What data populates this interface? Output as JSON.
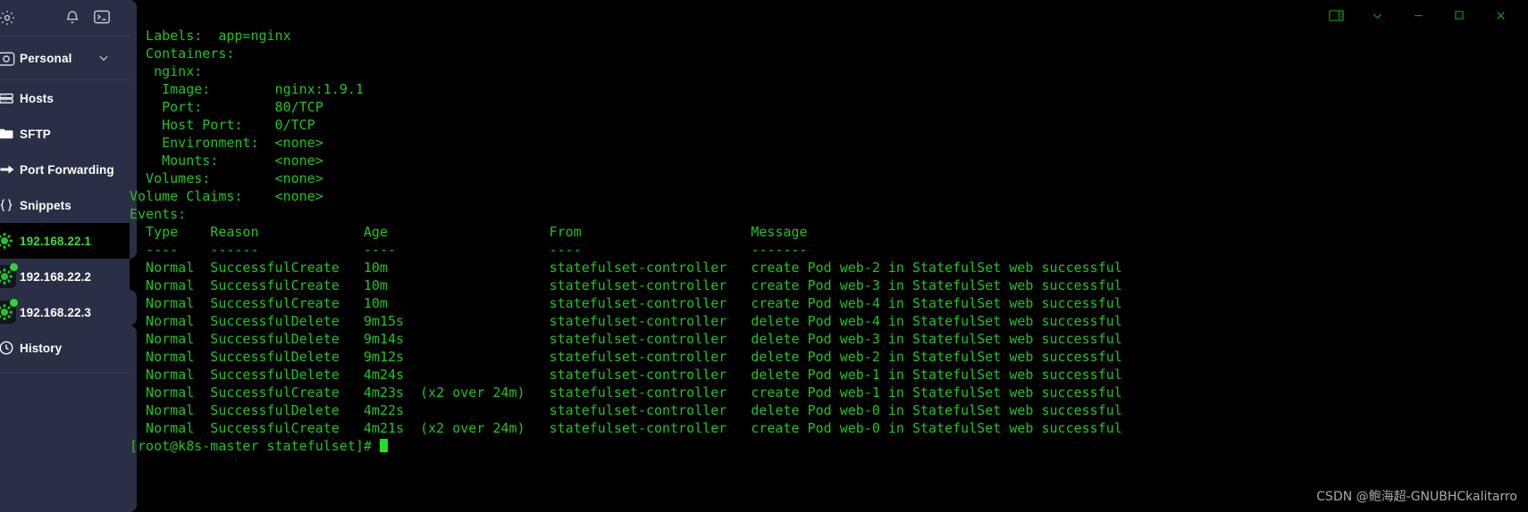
{
  "window_controls": [
    {
      "name": "split-pane",
      "glyph": "split"
    },
    {
      "name": "chevron-down",
      "glyph": "chev"
    },
    {
      "name": "minimize",
      "glyph": "min"
    },
    {
      "name": "maximize",
      "glyph": "max"
    },
    {
      "name": "close",
      "glyph": "close"
    }
  ],
  "sidebar": {
    "top_icons": [
      {
        "name": "settings-icon",
        "label": "Settings"
      },
      {
        "name": "bell-icon",
        "label": "Notifications"
      },
      {
        "name": "terminal-icon",
        "label": "Terminal"
      }
    ],
    "profile": {
      "label": "Personal",
      "icon": "account-icon",
      "chevron": "chevron-down-icon"
    },
    "items": [
      {
        "label": "Hosts",
        "icon": "hosts-icon"
      },
      {
        "label": "SFTP",
        "icon": "folder-icon"
      },
      {
        "label": "Port Forwarding",
        "icon": "arrow-right-icon"
      },
      {
        "label": "Snippets",
        "icon": "braces-icon"
      }
    ],
    "hosts": [
      {
        "label": "192.168.22.1",
        "active": true,
        "connected": false
      },
      {
        "label": "192.168.22.2",
        "active": false,
        "connected": true
      },
      {
        "label": "192.168.22.3",
        "active": false,
        "connected": true
      }
    ],
    "history": {
      "label": "History",
      "icon": "clock-icon"
    }
  },
  "terminal": {
    "prompt": "[root@k8s-master statefulset]#",
    "colors": {
      "fg": "#22c322",
      "bg": "#000000",
      "sidebar": "#2b2f45",
      "accent": "#2fd62f"
    },
    "lines": [
      "  Labels:  app=nginx",
      "  Containers:",
      "   nginx:",
      "    Image:        nginx:1.9.1",
      "    Port:         80/TCP",
      "    Host Port:    0/TCP",
      "    Environment:  <none>",
      "    Mounts:       <none>",
      "  Volumes:        <none>",
      "Volume Claims:    <none>",
      "Events:",
      "  Type    Reason             Age                    From                     Message",
      "  ----    ------             ----                   ----                     -------",
      "  Normal  SuccessfulCreate   10m                    statefulset-controller   create Pod web-2 in StatefulSet web successful",
      "  Normal  SuccessfulCreate   10m                    statefulset-controller   create Pod web-3 in StatefulSet web successful",
      "  Normal  SuccessfulCreate   10m                    statefulset-controller   create Pod web-4 in StatefulSet web successful",
      "  Normal  SuccessfulDelete   9m15s                  statefulset-controller   delete Pod web-4 in StatefulSet web successful",
      "  Normal  SuccessfulDelete   9m14s                  statefulset-controller   delete Pod web-3 in StatefulSet web successful",
      "  Normal  SuccessfulDelete   9m12s                  statefulset-controller   delete Pod web-2 in StatefulSet web successful",
      "  Normal  SuccessfulDelete   4m24s                  statefulset-controller   delete Pod web-1 in StatefulSet web successful",
      "  Normal  SuccessfulCreate   4m23s  (x2 over 24m)   statefulset-controller   create Pod web-1 in StatefulSet web successful",
      "  Normal  SuccessfulDelete   4m22s                  statefulset-controller   delete Pod web-0 in StatefulSet web successful",
      "  Normal  SuccessfulCreate   4m21s  (x2 over 24m)   statefulset-controller   create Pod web-0 in StatefulSet web successful"
    ]
  },
  "watermark": "CSDN @鲍海超-GNUBHCkalitarro"
}
